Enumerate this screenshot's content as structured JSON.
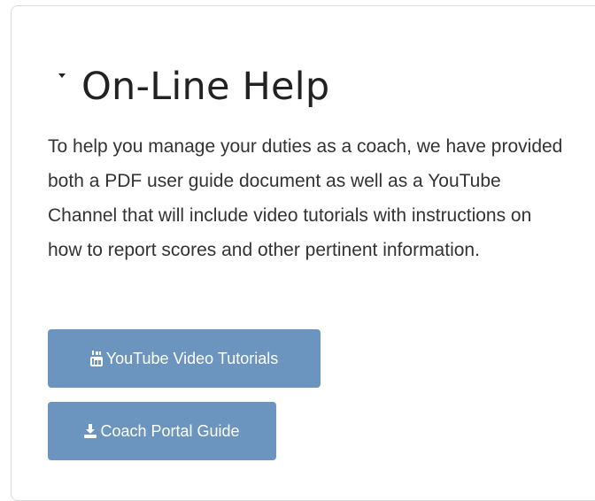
{
  "panel": {
    "title": "On-Line Help",
    "description": "To help you manage your duties as a coach, we have provided both a PDF user guide document as well as a YouTube Channel that will include video tutorials with instructions on how to report scores and other pertinent information.",
    "buttons": {
      "youtube_label": "YouTube Video Tutorials",
      "youtube_icon": "youtube-icon",
      "guide_label": "Coach Portal Guide",
      "guide_icon": "download-icon"
    }
  },
  "colors": {
    "button_bg": "#6b95be",
    "button_text": "#ffffff",
    "title_text": "#222222",
    "body_text": "#333333"
  }
}
